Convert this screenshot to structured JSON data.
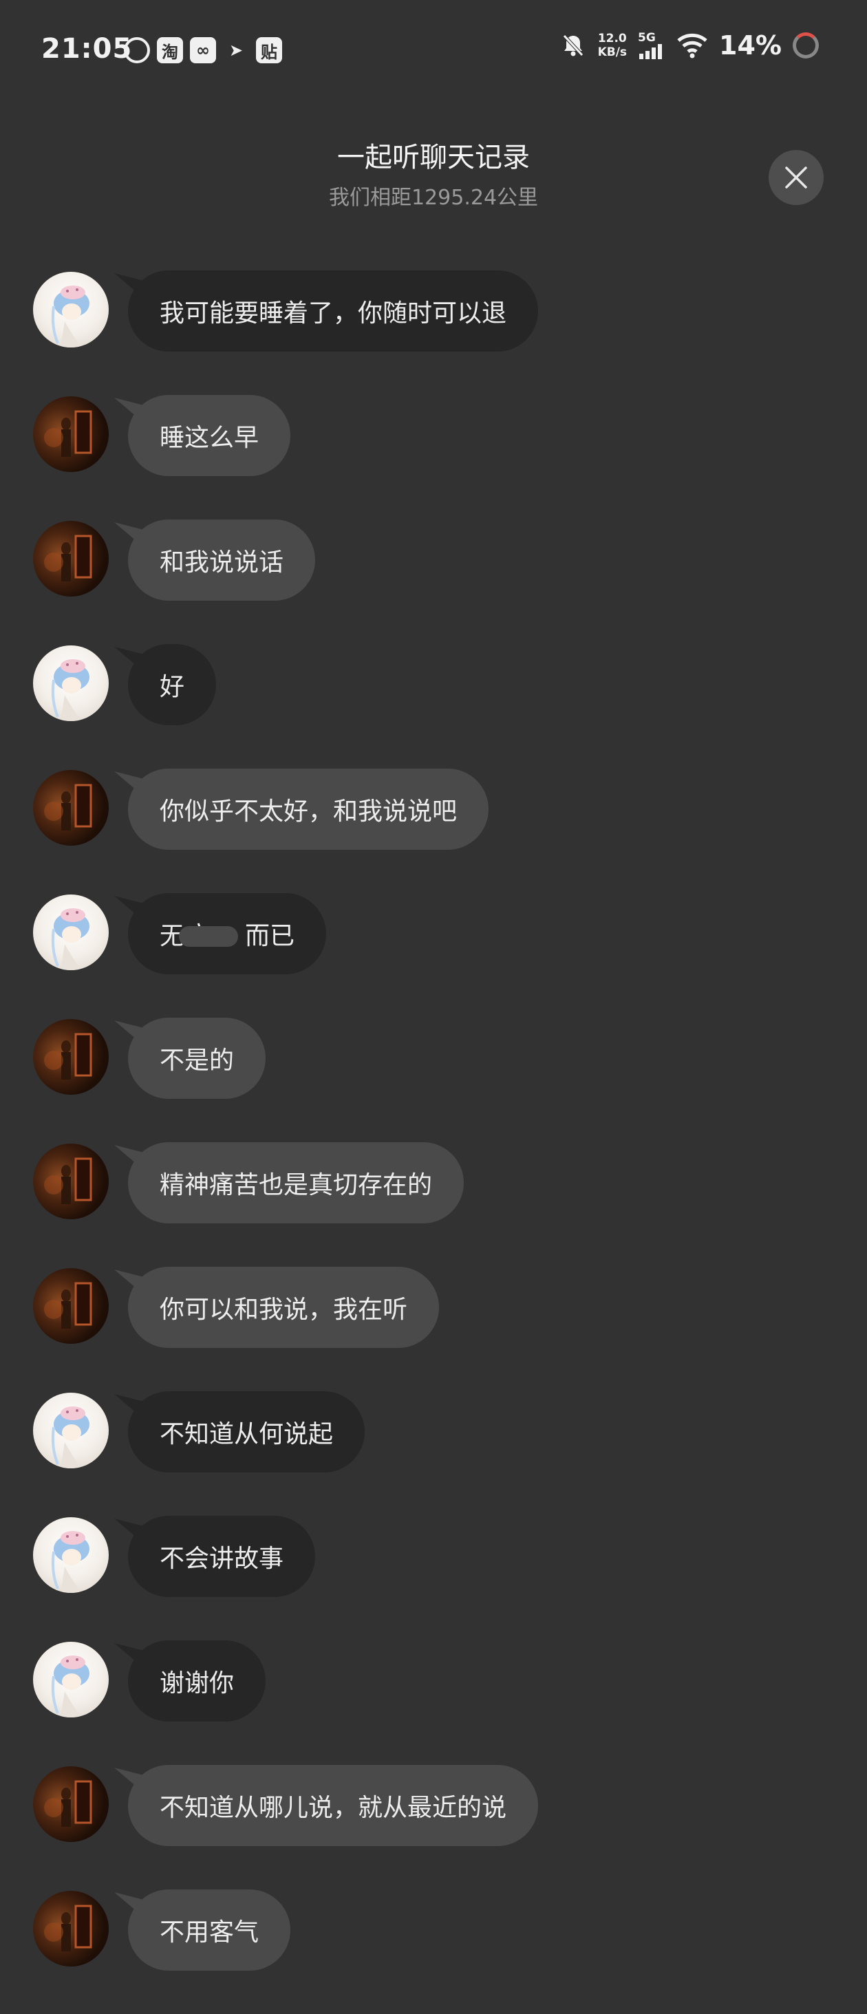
{
  "status_bar": {
    "time": "21:05",
    "apps": [
      "netease-music-icon",
      "taobao-icon",
      "baidu-cloud-icon",
      "xianyu-icon",
      "tieba-icon"
    ],
    "app_labels": {
      "taobao": "淘",
      "tieba": "贴"
    },
    "net_speed_value": "12.0",
    "net_speed_unit": "KB/s",
    "network_type": "5G",
    "battery_percent": "14%",
    "battery_level": 0.14
  },
  "header": {
    "title": "一起听聊天记录",
    "subtitle": "我们相距1295.24公里"
  },
  "colors": {
    "background": "#323232",
    "self_bubble": "#262626",
    "other_bubble": "#4a4a4a"
  },
  "messages": [
    {
      "sender": "light",
      "text": "我可能要睡着了，你随时可以退"
    },
    {
      "sender": "dark",
      "text": "睡这么早"
    },
    {
      "sender": "dark",
      "text": "和我说说话"
    },
    {
      "sender": "light",
      "text": "好"
    },
    {
      "sender": "dark",
      "text": "你似乎不太好，和我说说吧"
    },
    {
      "sender": "light",
      "text_before": "无病",
      "text_after": "而已",
      "redacted": true
    },
    {
      "sender": "dark",
      "text": "不是的"
    },
    {
      "sender": "dark",
      "text": "精神痛苦也是真切存在的"
    },
    {
      "sender": "dark",
      "text": "你可以和我说，我在听"
    },
    {
      "sender": "light",
      "text": "不知道从何说起"
    },
    {
      "sender": "light",
      "text": "不会讲故事"
    },
    {
      "sender": "light",
      "text": "谢谢你"
    },
    {
      "sender": "dark",
      "text": "不知道从哪儿说，就从最近的说"
    },
    {
      "sender": "dark",
      "text": "不用客气"
    }
  ]
}
